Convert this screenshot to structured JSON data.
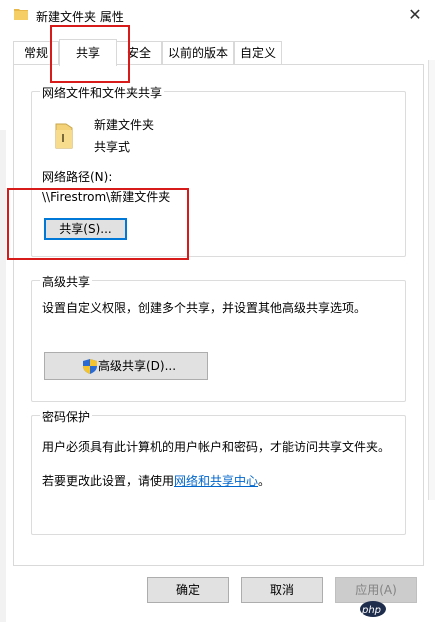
{
  "window": {
    "title": "新建文件夹 属性",
    "close_glyph": "✕"
  },
  "tabs": [
    {
      "label": "常规"
    },
    {
      "label": "共享"
    },
    {
      "label": "安全"
    },
    {
      "label": "以前的版本"
    },
    {
      "label": "自定义"
    }
  ],
  "network_sharing": {
    "group_title": "网络文件和文件夹共享",
    "folder_name": "新建文件夹",
    "share_status": "共享式",
    "network_path_label": "网络路径(N):",
    "network_path": "\\\\Firestrom\\新建文件夹",
    "share_button": "共享(S)..."
  },
  "advanced_sharing": {
    "group_title": "高级共享",
    "description": "设置自定义权限，创建多个共享，并设置其他高级共享选项。",
    "button": "高级共享(D)..."
  },
  "password_protection": {
    "group_title": "密码保护",
    "description": "用户必须具有此计算机的用户帐户和密码，才能访问共享文件夹。",
    "change_prefix": "若要更改此设置，请使用",
    "change_link": "网络和共享中心",
    "change_suffix": "。"
  },
  "footer": {
    "ok": "确定",
    "cancel": "取消",
    "apply": "应用(A)"
  },
  "watermark": {
    "text": "php 中文网"
  },
  "colors": {
    "highlight": "#d71b1b",
    "link": "#0066cc",
    "focus": "#0078d7"
  }
}
